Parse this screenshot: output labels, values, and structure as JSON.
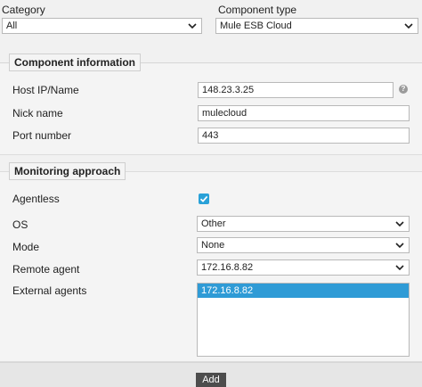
{
  "category": {
    "label": "Category",
    "value": "All"
  },
  "component_type": {
    "label": "Component type",
    "value": "Mule ESB Cloud"
  },
  "component_info": {
    "title": "Component information",
    "host_label": "Host IP/Name",
    "host_value": "148.23.3.25",
    "nick_label": "Nick name",
    "nick_value": "mulecloud",
    "port_label": "Port number",
    "port_value": "443",
    "help_glyph": "?"
  },
  "monitoring": {
    "title": "Monitoring approach",
    "agentless_label": "Agentless",
    "agentless_checked": true,
    "os_label": "OS",
    "os_value": "Other",
    "mode_label": "Mode",
    "mode_value": "None",
    "remote_label": "Remote agent",
    "remote_value": "172.16.8.82",
    "external_label": "External agents",
    "external_items": [
      "172.16.8.82"
    ]
  },
  "actions": {
    "add_label": "Add"
  },
  "colors": {
    "accent": "#29a1d8",
    "selection": "#2f9bd6",
    "button": "#4d4d4d"
  }
}
